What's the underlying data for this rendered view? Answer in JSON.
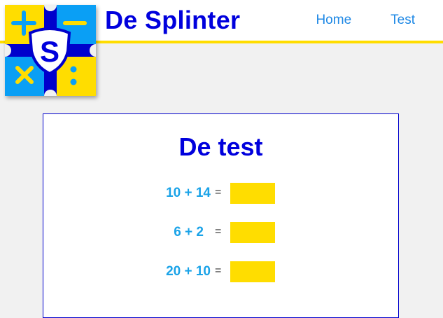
{
  "header": {
    "brand": "De Splinter",
    "nav": [
      {
        "label": "Home"
      },
      {
        "label": "Test"
      }
    ]
  },
  "logo": {
    "letter": "S",
    "operators": [
      "+",
      "−",
      "×",
      "÷"
    ],
    "colors": {
      "blue": "#0a9ff5",
      "yellow": "#ffdd00",
      "navy": "#0000cc"
    }
  },
  "test": {
    "title": "De test",
    "questions": [
      {
        "expression": "10 + 14",
        "equals": "=",
        "answer": ""
      },
      {
        "expression": "6 + 2",
        "equals": "=",
        "answer": ""
      },
      {
        "expression": "20 + 10",
        "equals": "=",
        "answer": ""
      }
    ]
  },
  "colors": {
    "accent": "#0000dd",
    "link": "#1e88e5",
    "expression": "#1aa3e8",
    "input_fill": "#ffdd00",
    "header_border": "#ffdd00"
  }
}
